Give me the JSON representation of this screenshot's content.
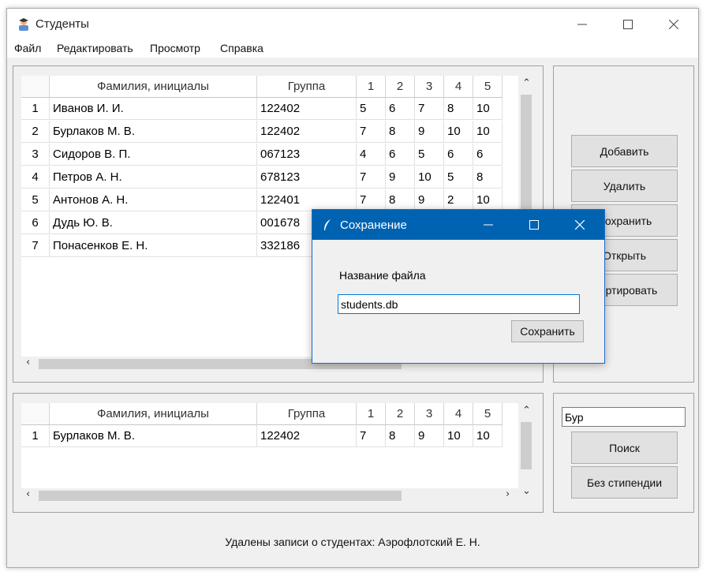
{
  "window": {
    "title": "Студенты",
    "icon": "students-app-icon",
    "controls": [
      "minimize-icon",
      "maximize-icon",
      "close-icon"
    ]
  },
  "menu": [
    "Файл",
    "Редактировать",
    "Просмотр",
    "Справка"
  ],
  "main_table": {
    "headers": [
      "Фамилия, инициалы",
      "Группа",
      "1",
      "2",
      "3",
      "4",
      "5"
    ],
    "rows": [
      {
        "n": "1",
        "name": "Иванов И. И.",
        "group": "122402",
        "g": [
          "5",
          "6",
          "7",
          "8",
          "10"
        ]
      },
      {
        "n": "2",
        "name": "Бурлаков М. В.",
        "group": "122402",
        "g": [
          "7",
          "8",
          "9",
          "10",
          "10"
        ]
      },
      {
        "n": "3",
        "name": "Сидоров В. П.",
        "group": "067123",
        "g": [
          "4",
          "6",
          "5",
          "6",
          "6"
        ]
      },
      {
        "n": "4",
        "name": "Петров А. Н.",
        "group": "678123",
        "g": [
          "7",
          "9",
          "10",
          "5",
          "8"
        ]
      },
      {
        "n": "5",
        "name": "Антонов А. Н.",
        "group": "122401",
        "g": [
          "7",
          "8",
          "9",
          "2",
          "10"
        ]
      },
      {
        "n": "6",
        "name": "Дудь Ю. В.",
        "group": "001678",
        "g": [
          "",
          "",
          "",
          "",
          ""
        ]
      },
      {
        "n": "7",
        "name": "Понасенков Е. Н.",
        "group": "332186",
        "g": [
          "",
          "",
          "",
          "",
          ""
        ]
      }
    ]
  },
  "buttons": {
    "add": "Добавить",
    "delete": "Удалить",
    "save": "Сохранить",
    "open": "Открыть",
    "sort": "Сортировать",
    "search": "Поиск",
    "no_scholarship": "Без стипендии"
  },
  "search_table": {
    "headers": [
      "Фамилия, инициалы",
      "Группа",
      "1",
      "2",
      "3",
      "4",
      "5"
    ],
    "rows": [
      {
        "n": "1",
        "name": "Бурлаков М. В.",
        "group": "122402",
        "g": [
          "7",
          "8",
          "9",
          "10",
          "10"
        ]
      }
    ]
  },
  "search": {
    "value": "Бур"
  },
  "status": "Удалены записи о студентах: Аэрофлотский Е. Н.",
  "dialog": {
    "title": "Сохранение",
    "label": "Название файла",
    "value": "students.db",
    "button": "Сохранить"
  },
  "colors": {
    "accent": "#0063b1",
    "window_bg": "#f0f0f0"
  }
}
